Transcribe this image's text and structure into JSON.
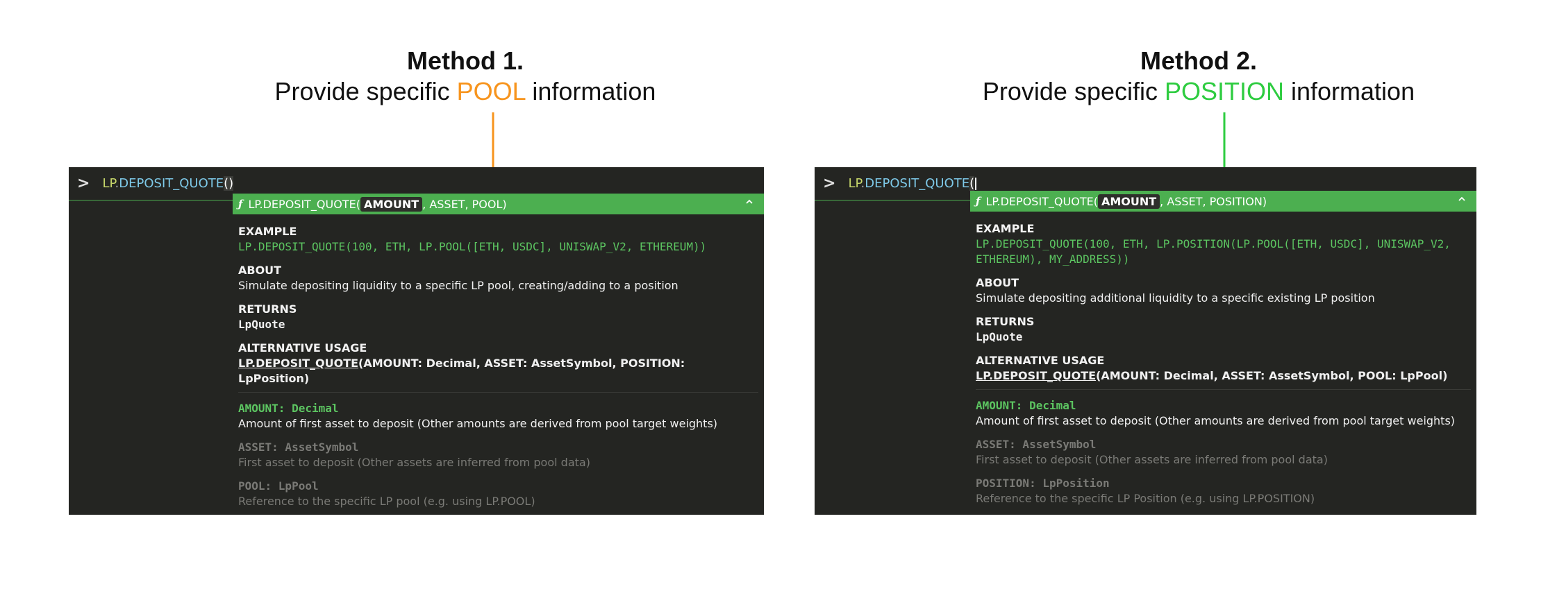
{
  "method1": {
    "title": "Method 1.",
    "subtitle_pre": "Provide specific ",
    "subtitle_highlight": "POOL",
    "subtitle_post": " information",
    "highlight_color": "#f7941d"
  },
  "method2": {
    "title": "Method 2.",
    "subtitle_pre": "Provide specific ",
    "subtitle_highlight": "POSITION",
    "subtitle_post": " information",
    "highlight_color": "#2ecc40"
  },
  "panel1": {
    "prompt": ">",
    "cmd_lp": "LP",
    "cmd_dot": ".",
    "cmd_fn": "DEPOSIT_QUOTE",
    "cmd_paren": "()",
    "sig_icon": "ƒ",
    "sig_pre": "LP.DEPOSIT_QUOTE(",
    "sig_active": "AMOUNT",
    "sig_post": ", ASSET, POOL)",
    "collapse_icon": "^",
    "example_label": "EXAMPLE",
    "example_code": "LP.DEPOSIT_QUOTE(100, ETH, LP.POOL([ETH, USDC], UNISWAP_V2, ETHEREUM))",
    "about_label": "ABOUT",
    "about_text": "Simulate depositing liquidity to a specific LP pool, creating/adding to a position",
    "returns_label": "RETURNS",
    "returns_type": "LpQuote",
    "alt_label": "ALTERNATIVE USAGE",
    "alt_fn": "LP.DEPOSIT_QUOTE",
    "alt_args": "(AMOUNT: Decimal, ASSET: AssetSymbol, POSITION: LpPosition)",
    "params": [
      {
        "name": "AMOUNT: Decimal",
        "desc": "Amount of first asset to deposit (Other amounts are derived from pool target weights)"
      },
      {
        "name": "ASSET: AssetSymbol",
        "desc": "First asset to deposit (Other assets are inferred from pool data)"
      },
      {
        "name": "POOL: LpPool",
        "desc": "Reference to the specific LP pool (e.g. using LP.POOL)"
      }
    ]
  },
  "panel2": {
    "prompt": ">",
    "cmd_lp": "LP",
    "cmd_dot": ".",
    "cmd_fn": "DEPOSIT_QUOTE",
    "cmd_paren": "(",
    "sig_icon": "ƒ",
    "sig_pre": "LP.DEPOSIT_QUOTE(",
    "sig_active": "AMOUNT",
    "sig_post": ", ASSET, POSITION)",
    "collapse_icon": "^",
    "example_label": "EXAMPLE",
    "example_code_line1": "LP.DEPOSIT_QUOTE(100, ETH, LP.POSITION(LP.POOL([ETH, USDC], UNISWAP_V2,",
    "example_code_line2": "ETHEREUM), MY_ADDRESS))",
    "about_label": "ABOUT",
    "about_text": "Simulate depositing additional liquidity to a specific existing LP position",
    "returns_label": "RETURNS",
    "returns_type": "LpQuote",
    "alt_label": "ALTERNATIVE USAGE",
    "alt_fn": "LP.DEPOSIT_QUOTE",
    "alt_args": "(AMOUNT: Decimal, ASSET: AssetSymbol, POOL: LpPool)",
    "params": [
      {
        "name": "AMOUNT: Decimal",
        "desc": "Amount of first asset to deposit (Other amounts are derived from pool target weights)"
      },
      {
        "name": "ASSET: AssetSymbol",
        "desc": "First asset to deposit (Other assets are inferred from pool data)"
      },
      {
        "name": "POSITION: LpPosition",
        "desc": "Reference to the specific LP Position (e.g. using LP.POSITION)"
      }
    ]
  }
}
